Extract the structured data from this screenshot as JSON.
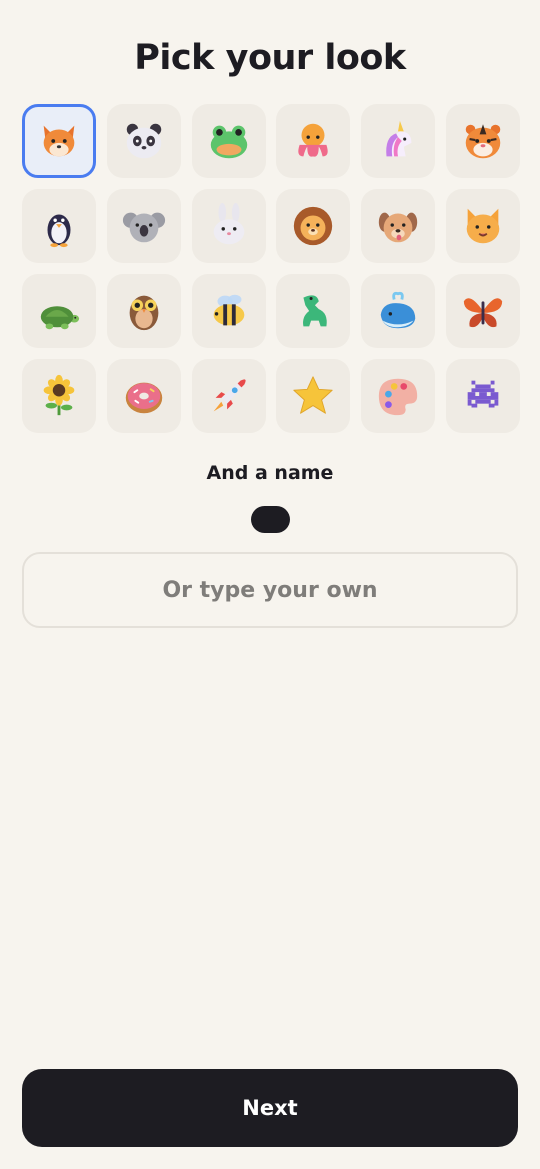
{
  "header": {
    "title": "Pick your look"
  },
  "avatars": [
    {
      "icon": "fox-icon",
      "selected": true
    },
    {
      "icon": "panda-icon",
      "selected": false
    },
    {
      "icon": "frog-icon",
      "selected": false
    },
    {
      "icon": "octopus-icon",
      "selected": false
    },
    {
      "icon": "unicorn-icon",
      "selected": false
    },
    {
      "icon": "tiger-icon",
      "selected": false
    },
    {
      "icon": "penguin-icon",
      "selected": false
    },
    {
      "icon": "koala-icon",
      "selected": false
    },
    {
      "icon": "rabbit-icon",
      "selected": false
    },
    {
      "icon": "lion-icon",
      "selected": false
    },
    {
      "icon": "dog-icon",
      "selected": false
    },
    {
      "icon": "cat-icon",
      "selected": false
    },
    {
      "icon": "turtle-icon",
      "selected": false
    },
    {
      "icon": "owl-icon",
      "selected": false
    },
    {
      "icon": "bee-icon",
      "selected": false
    },
    {
      "icon": "dinosaur-icon",
      "selected": false
    },
    {
      "icon": "whale-icon",
      "selected": false
    },
    {
      "icon": "butterfly-icon",
      "selected": false
    },
    {
      "icon": "sunflower-icon",
      "selected": false
    },
    {
      "icon": "donut-icon",
      "selected": false
    },
    {
      "icon": "rocket-icon",
      "selected": false
    },
    {
      "icon": "star-icon",
      "selected": false
    },
    {
      "icon": "palette-icon",
      "selected": false
    },
    {
      "icon": "space-invader-icon",
      "selected": false
    }
  ],
  "name_section": {
    "heading": "And a name",
    "custom_placeholder": "Or type your own"
  },
  "footer": {
    "next_label": "Next"
  },
  "colors": {
    "background": "#f7f4ee",
    "tile": "#efebe4",
    "selected_border": "#4a7cf0",
    "dark": "#1d1c22"
  }
}
